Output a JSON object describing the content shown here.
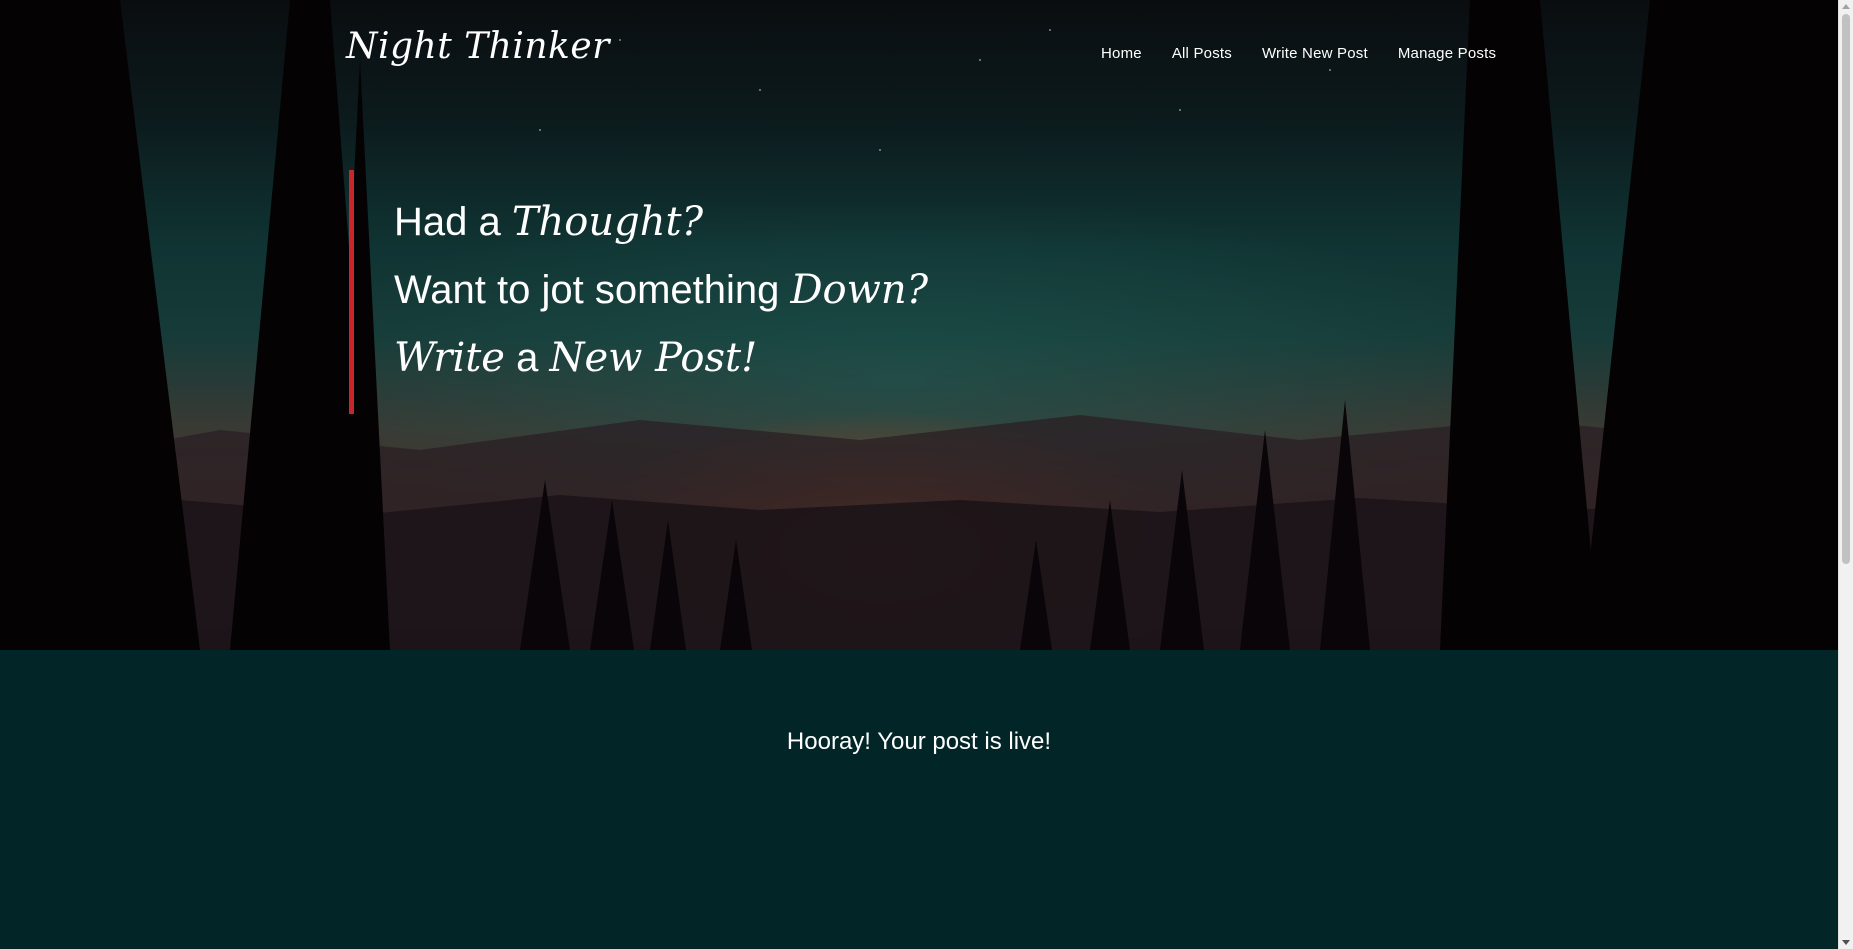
{
  "header": {
    "brand": "Night Thinker",
    "nav": [
      "Home",
      "All Posts",
      "Write New Post",
      "Manage Posts"
    ]
  },
  "hero": {
    "line1": {
      "plain": "Had a ",
      "script": "Thought?"
    },
    "line2": {
      "plain": "Want to jot something ",
      "script": "Down?"
    },
    "line3": {
      "script_a": "Write",
      "plain": " a ",
      "script_b": "New Post!"
    }
  },
  "main": {
    "message": "Hooray! Your post is live!"
  },
  "colors": {
    "accent": "#c8262c",
    "background": "#022628",
    "text": "#ffffff"
  }
}
